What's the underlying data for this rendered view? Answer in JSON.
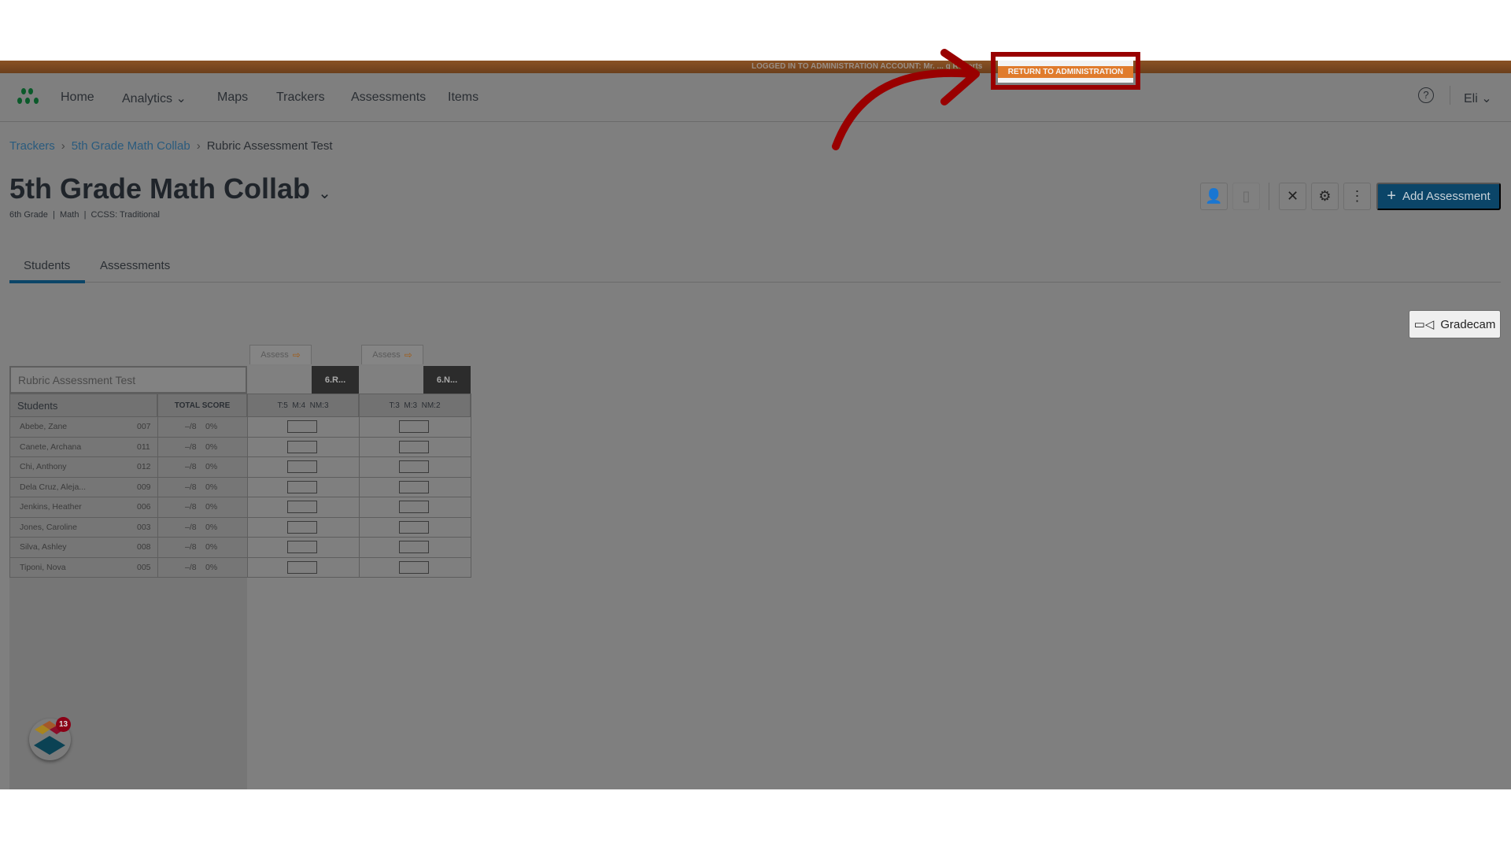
{
  "banner": {
    "text": "LOGGED IN TO ADMINISTRATION ACCOUNT: Mr. ... g Roberts",
    "return_label": "RETURN TO ADMINISTRATION"
  },
  "nav": {
    "items": [
      "Home",
      "Analytics",
      "Maps",
      "Trackers",
      "Assessments",
      "Items"
    ],
    "user": "Eli"
  },
  "breadcrumb": [
    "Trackers",
    "5th Grade Math Collab",
    "Rubric Assessment Test"
  ],
  "header": {
    "title": "5th Grade Math Collab",
    "subtitle": "6th Grade  |  Math  |  CCSS: Traditional",
    "add_label": "Add Assessment"
  },
  "tabs": [
    "Students",
    "Assessments"
  ],
  "gradecam_label": "Gradecam",
  "table": {
    "title": "Rubric Assessment Test",
    "students_header": "Students",
    "score_header": "TOTAL SCORE",
    "assess_label": "Assess",
    "standards": [
      {
        "code": "6.R...",
        "counts": "T:5  M:4  NM:3"
      },
      {
        "code": "6.N...",
        "counts": "T:3  M:3  NM:2"
      }
    ],
    "rows": [
      {
        "name": "Abebe, Zane",
        "id": "007",
        "score": "–/8",
        "pct": "0%"
      },
      {
        "name": "Canete, Archana",
        "id": "011",
        "score": "–/8",
        "pct": "0%"
      },
      {
        "name": "Chi, Anthony",
        "id": "012",
        "score": "–/8",
        "pct": "0%"
      },
      {
        "name": "Dela Cruz, Aleja...",
        "id": "009",
        "score": "–/8",
        "pct": "0%"
      },
      {
        "name": "Jenkins, Heather",
        "id": "006",
        "score": "–/8",
        "pct": "0%"
      },
      {
        "name": "Jones, Caroline",
        "id": "003",
        "score": "–/8",
        "pct": "0%"
      },
      {
        "name": "Silva, Ashley",
        "id": "008",
        "score": "–/8",
        "pct": "0%"
      },
      {
        "name": "Tiponi, Nova",
        "id": "005",
        "score": "–/8",
        "pct": "0%"
      }
    ]
  },
  "widget_badge": "13",
  "colors": {
    "accent": "#0b4568",
    "highlight": "#990000",
    "banner_button": "#e07b2c"
  }
}
